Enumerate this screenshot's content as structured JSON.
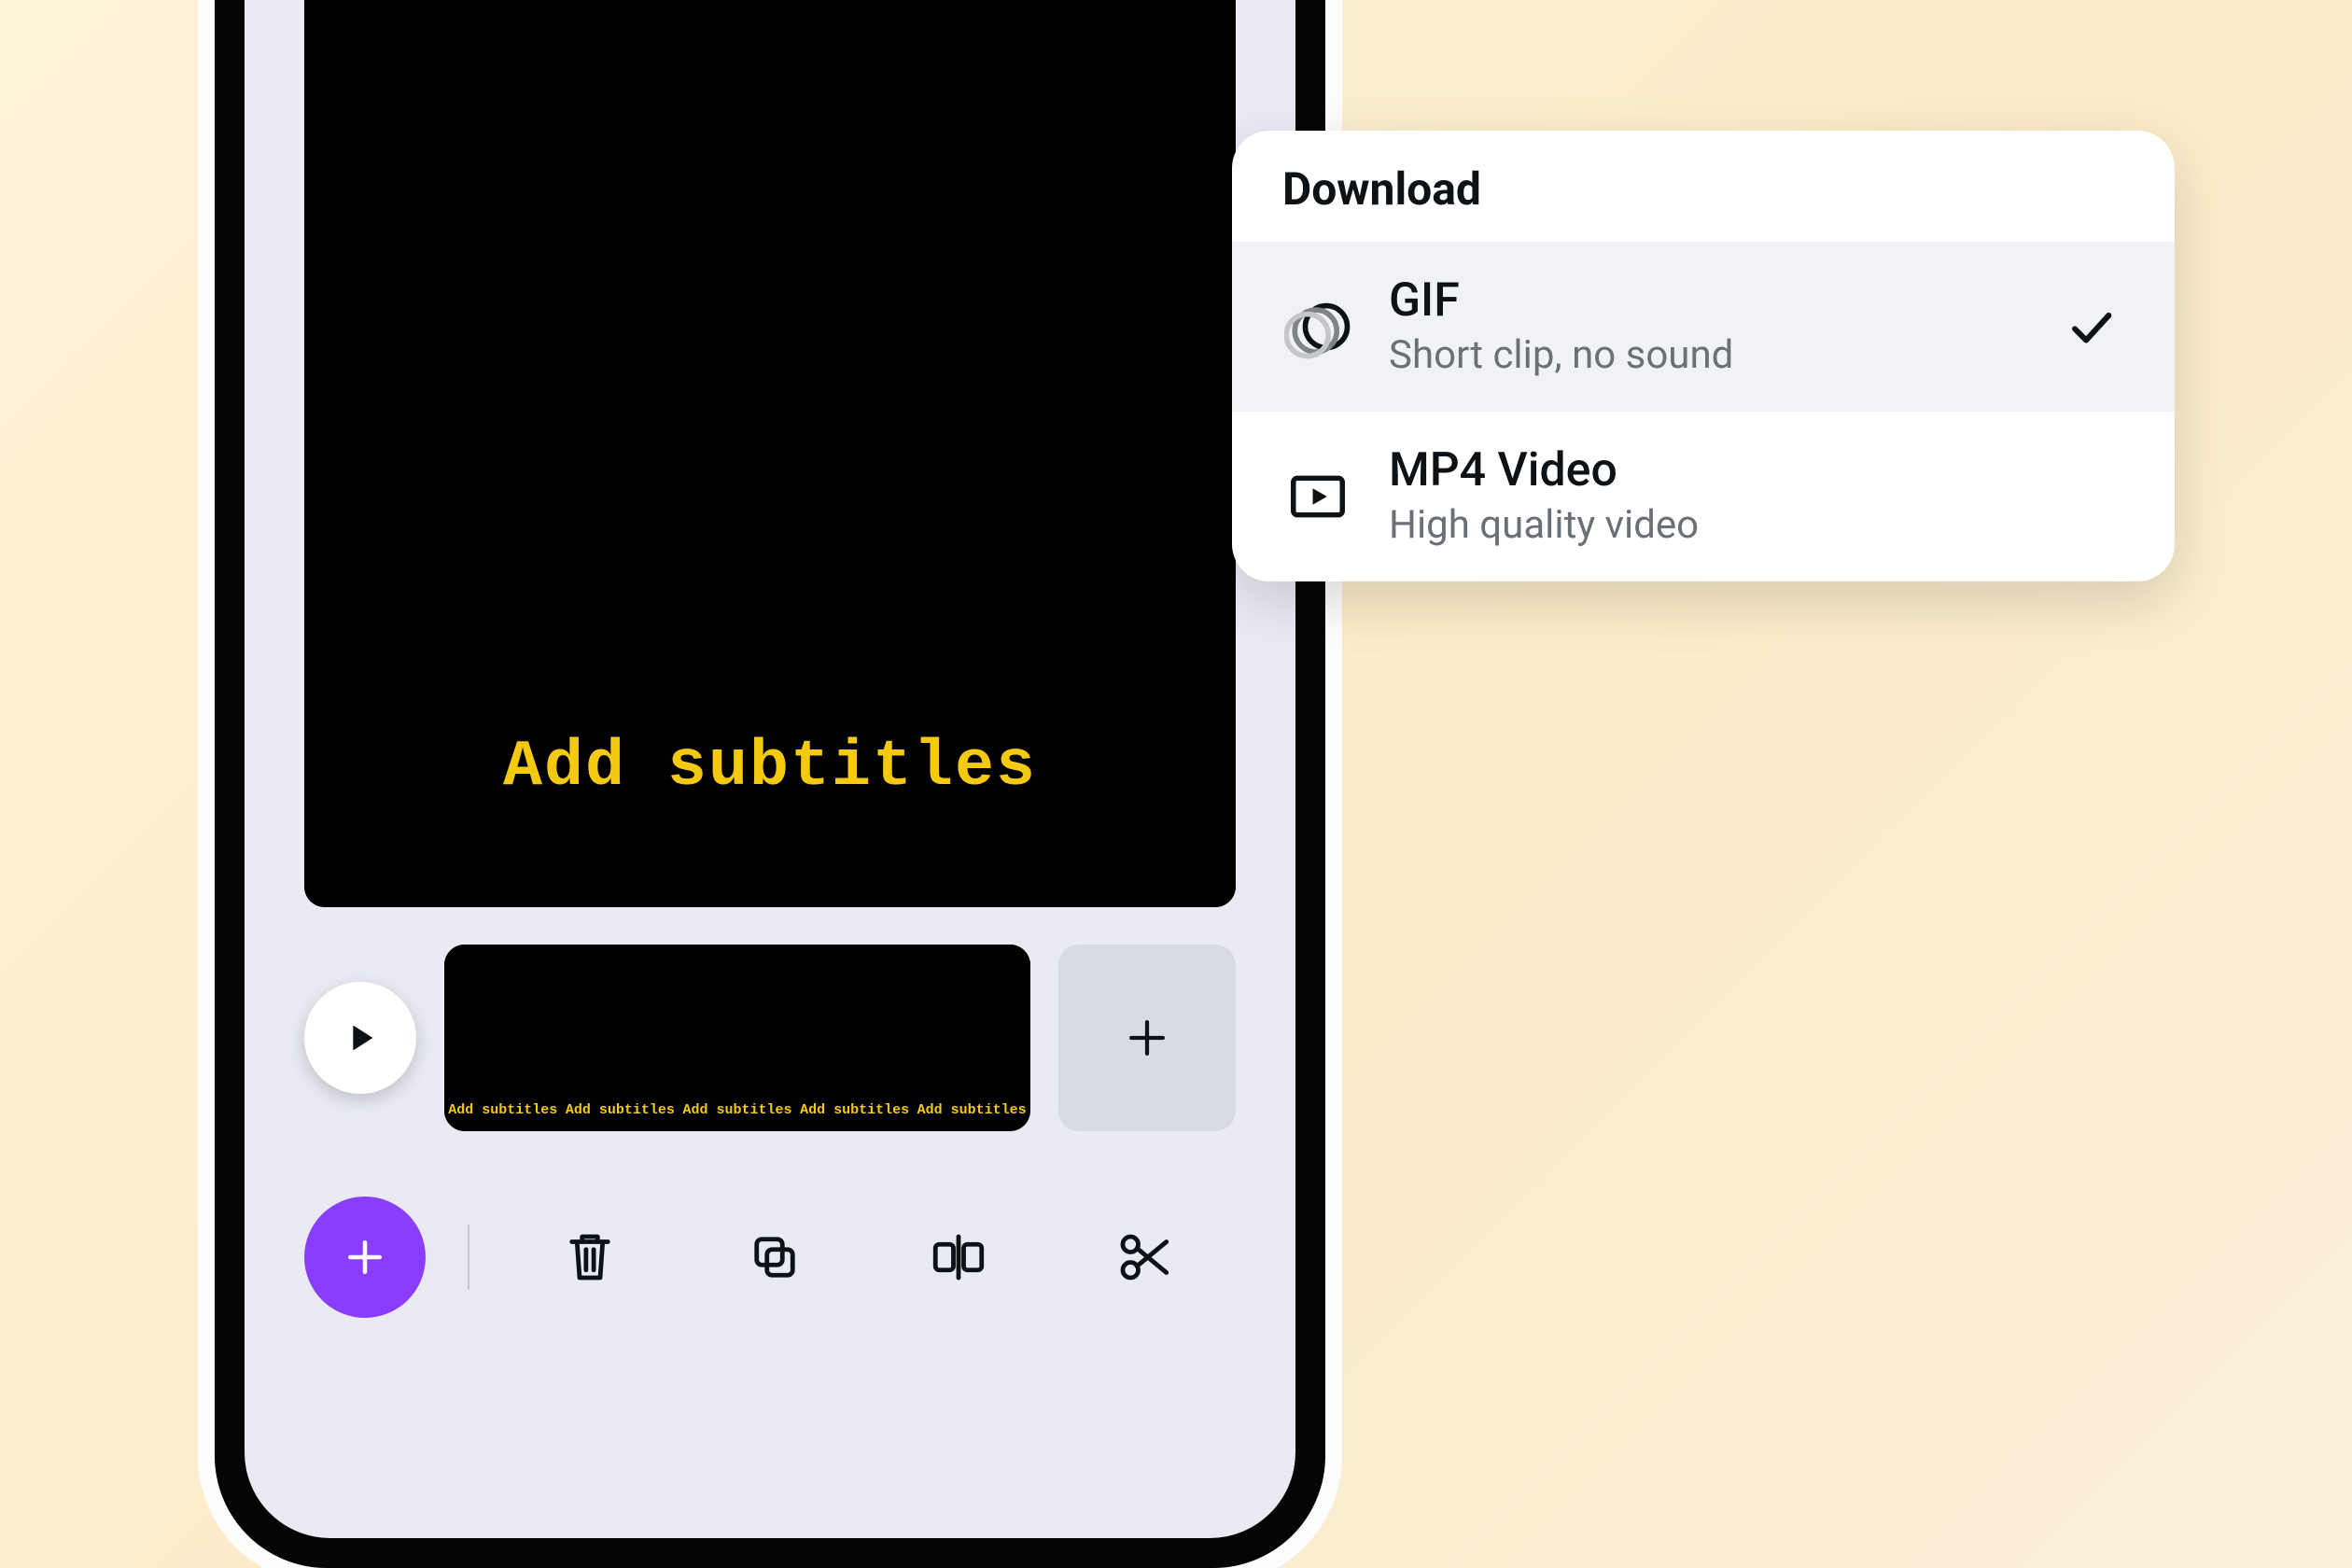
{
  "canvas": {
    "subtitle_text": "Add subtitles"
  },
  "timeline": {
    "thumb_label": "Add subtitles"
  },
  "download_menu": {
    "title": "Download",
    "options": [
      {
        "title": "GIF",
        "subtitle": "Short clip, no sound",
        "selected": true
      },
      {
        "title": "MP4 Video",
        "subtitle": "High quality video",
        "selected": false
      }
    ]
  },
  "colors": {
    "accent": "#8b3dff",
    "subtitle": "#f4c90f",
    "hoop": "#ff2e8a",
    "suit": "#e21d25"
  }
}
